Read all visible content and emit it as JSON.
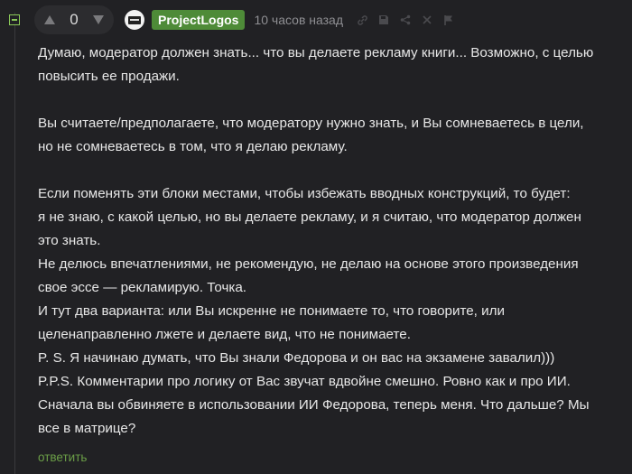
{
  "comment": {
    "votes": {
      "count": "0",
      "up_icon": "triangle-up-icon",
      "down_icon": "triangle-down-icon"
    },
    "author": {
      "username": "ProjectLogos",
      "avatar_icon": "avatar-icon"
    },
    "timestamp": "10 часов назад",
    "actions": [
      "link-icon",
      "save-icon",
      "share-icon",
      "more-icon",
      "report-flag-icon"
    ],
    "paragraphs": [
      [
        "Думаю, модератор должен знать... что вы делаете рекламу книги... Возможно, с целью",
        "повысить ее продажи."
      ],
      [
        "Вы считаете/предполагаете, что модератору нужно знать, и Вы сомневаетесь в цели,",
        "но не сомневаетесь в том, что я делаю рекламу."
      ],
      [
        "Если поменять эти блоки местами, чтобы избежать вводных конструкций, то будет:",
        "я не знаю, с какой целью, но вы делаете рекламу, и я считаю, что модератор должен",
        "это знать.",
        "Не делюсь впечатлениями, не рекомендую, не делаю на основе этого произведения",
        "свое эссе — рекламирую. Точка.",
        "И тут два варианта: или Вы искренне не понимаете то, что говорите, или",
        "целенаправленно лжете и делаете вид, что не понимаете.",
        "P. S. Я начинаю думать, что Вы знали Федорова и он вас на экзамене завалил)))",
        "P.P.S. Комментарии про логику от Вас звучат вдвойне смешно. Ровно как и про ИИ.",
        "Сначала вы обвиняете в использовании ИИ Федорова, теперь меня. Что дальше? Мы",
        "все в матрице?"
      ]
    ],
    "reply_label": "ответить"
  },
  "colors": {
    "background": "#212124",
    "username_badge": "#4e8b38",
    "reply_link": "#6b9e47",
    "text": "#e7e7e7",
    "muted": "#8e8e92"
  }
}
